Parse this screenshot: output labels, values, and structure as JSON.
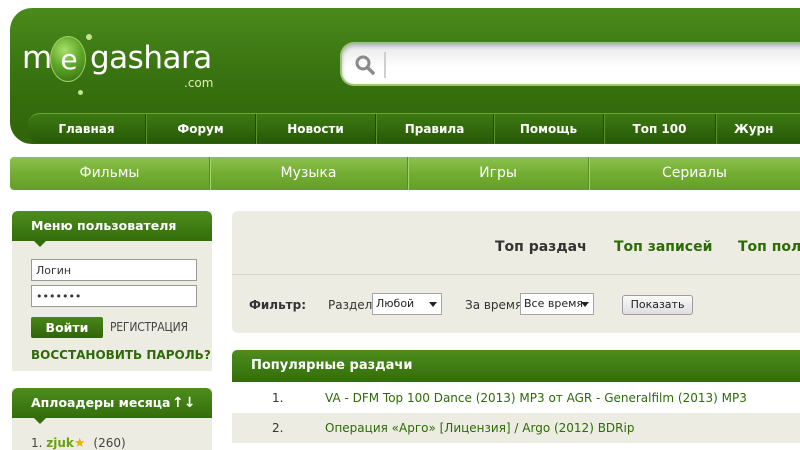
{
  "logo": {
    "text_before": "m",
    "ball_letter": "e",
    "text_after": "gashara",
    "sub": ".com"
  },
  "search": {
    "icon": "search-icon",
    "value": ""
  },
  "top_nav": [
    "Главная",
    "Форум",
    "Новости",
    "Правила",
    "Помощь",
    "Топ 100",
    "Журн"
  ],
  "categories": [
    "Фильмы",
    "Музыка",
    "Игры",
    "Сериалы"
  ],
  "user_menu": {
    "title": "Меню пользователя",
    "login_placeholder": "Логин",
    "password_value": "•••••••",
    "login_button": "Войти",
    "register_link": "РЕГИСТРАЦИЯ",
    "restore_link": "ВОССТАНОВИТЬ ПАРОЛЬ?"
  },
  "uploaders": {
    "title": "Аплоадеры месяца",
    "sort_icon": "sort-arrows-icon",
    "items": [
      {
        "rank": "1.",
        "name": "zjuk",
        "badge_icon": "star-icon",
        "count": "(260)"
      }
    ]
  },
  "tabs": [
    "Топ раздач",
    "Топ записей",
    "Топ поль"
  ],
  "filter": {
    "label": "Фильтр:",
    "section_label": "Раздел",
    "section_value": "Любой",
    "time_label": "За время",
    "time_value": "Все время",
    "submit": "Показать"
  },
  "popular": {
    "title": "Популярные раздачи",
    "items": [
      {
        "num": "1.",
        "title": "VA - DFM Top 100 Dance (2013) MP3 от AGR - Generalfilm (2013) MP3"
      },
      {
        "num": "2.",
        "title": "Операция «Арго» [Лицензия] / Argo (2012) BDRip"
      }
    ]
  },
  "colors": {
    "brand_green": "#336d0b",
    "light_green": "#74ad33",
    "link_green": "#2e6b06",
    "panel_bg": "#ecece2"
  }
}
